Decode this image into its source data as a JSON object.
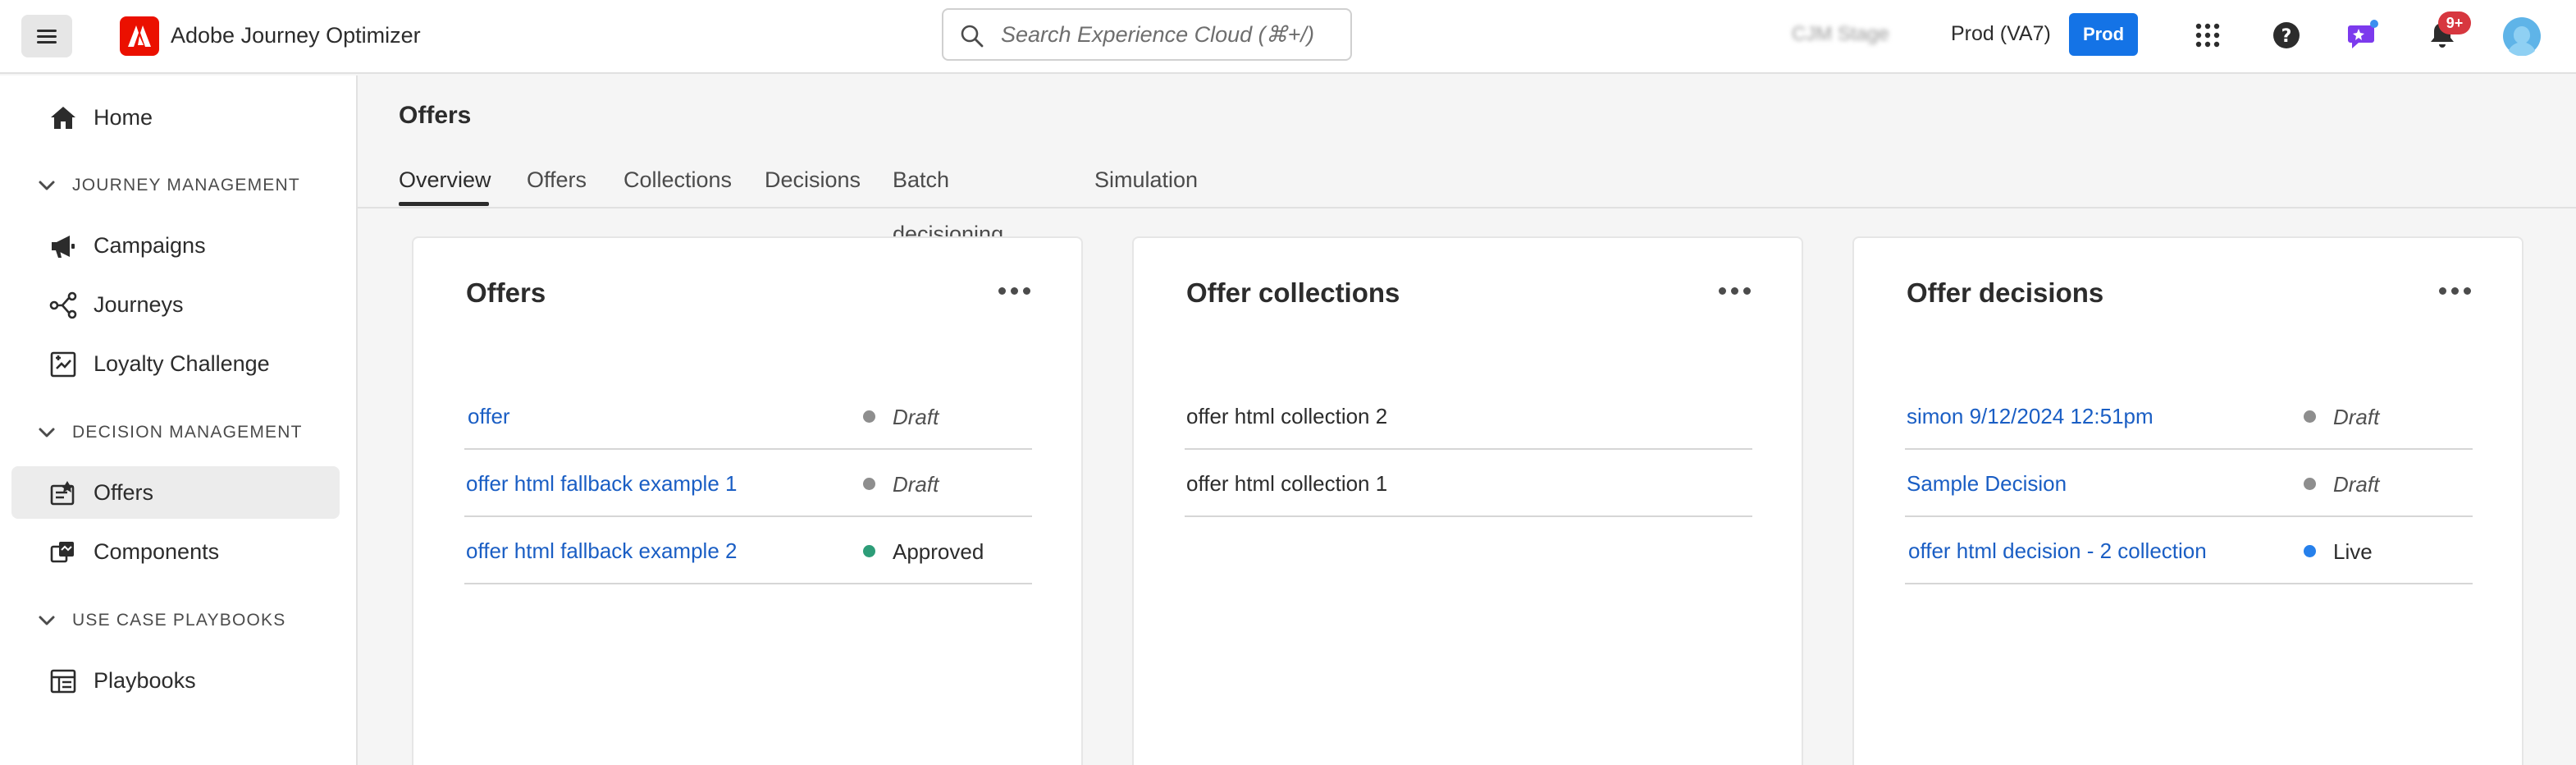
{
  "app": {
    "title": "Adobe Journey Optimizer"
  },
  "search": {
    "placeholder": "Search Experience Cloud (⌘+/)"
  },
  "topbar": {
    "org": "CJM Stage",
    "sandbox": "Prod (VA7)",
    "env_badge": "Prod",
    "notification_count": "9+"
  },
  "sidebar": {
    "home": "Home",
    "sections": [
      {
        "label": "JOURNEY MANAGEMENT",
        "items": [
          "Campaigns",
          "Journeys",
          "Loyalty Challenge"
        ]
      },
      {
        "label": "DECISION MANAGEMENT",
        "items": [
          "Offers",
          "Components"
        ]
      },
      {
        "label": "USE CASE PLAYBOOKS",
        "items": [
          "Playbooks"
        ]
      }
    ]
  },
  "main": {
    "title": "Offers",
    "tabs": [
      "Overview",
      "Offers",
      "Collections",
      "Decisions",
      "Batch decisioning",
      "Simulation"
    ],
    "active_tab": "Overview",
    "cards": [
      {
        "title": "Offers",
        "rows": [
          {
            "name": "offer",
            "status": "Draft"
          },
          {
            "name": "offer html fallback example 1",
            "status": "Draft"
          },
          {
            "name": "offer html fallback example 2",
            "status": "Approved"
          }
        ]
      },
      {
        "title": "Offer collections",
        "rows": [
          {
            "name": "offer html collection 2"
          },
          {
            "name": "offer html collection 1"
          }
        ]
      },
      {
        "title": "Offer decisions",
        "rows": [
          {
            "name": "simon 9/12/2024 12:51pm",
            "status": "Draft"
          },
          {
            "name": "Sample Decision",
            "status": "Draft"
          },
          {
            "name": "offer html decision - 2 collection",
            "status": "Live"
          }
        ]
      }
    ]
  },
  "colors": {
    "brand_red": "#eb1000",
    "accent_blue": "#1473e6",
    "link_blue": "#1a5ec4",
    "status_draft": "#8e8e8e",
    "status_approved": "#2d9d78",
    "status_live": "#2680eb",
    "notification_red": "#d7373f"
  },
  "icons": [
    "hamburger-icon",
    "adobe-logo-icon",
    "search-icon",
    "apps-grid-icon",
    "help-icon",
    "feedback-icon",
    "bell-icon",
    "avatar",
    "home-icon",
    "chevron-down-icon",
    "megaphone-icon",
    "journey-icon",
    "loyalty-icon",
    "offers-icon",
    "components-icon",
    "playbooks-icon",
    "more-icon"
  ]
}
